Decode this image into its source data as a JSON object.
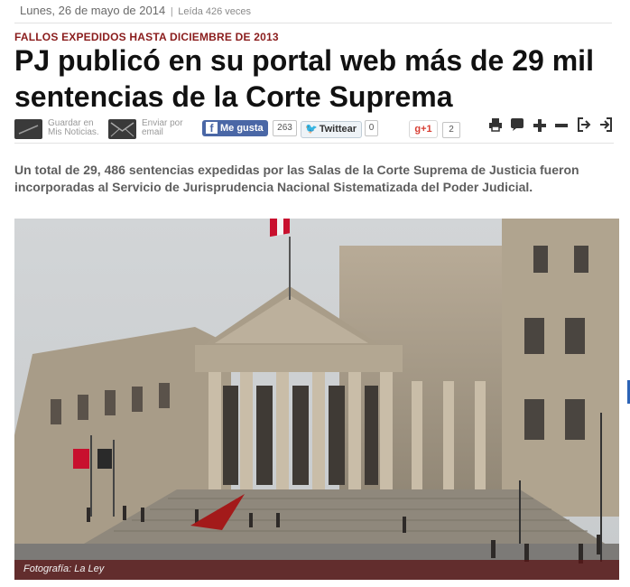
{
  "meta": {
    "date": "Lunes,  26 de mayo de 2014",
    "separator": "|",
    "reads": "Leída 426 veces"
  },
  "article": {
    "kicker": "FALLOS EXPEDIDOS HASTA DICIEMBRE DE 2013",
    "headline": "PJ publicó en su portal web más de 29 mil sentencias de la Corte Suprema",
    "lead": "Un total de 29, 486 sentencias expedidas por las Salas de la Corte Suprema de Justicia fueron incorporadas al Servicio de Jurisprudencia Nacional Sistematizada del Poder Judicial.",
    "photo_caption": "Fotografía: La Ley"
  },
  "toolbar": {
    "save_line1": "Guardar en",
    "save_line2": "Mis Noticias.",
    "email_line1": "Enviar por",
    "email_line2": "email",
    "facebook_label": "Me gusta",
    "facebook_count": "263",
    "twitter_label": "Twittear",
    "twitter_count": "0",
    "gplus_label": "+1",
    "gplus_count": "2"
  },
  "icons": {
    "print": "print-icon",
    "comment": "comment-icon",
    "font_increase": "plus-icon",
    "font_decrease": "minus-icon",
    "share_in": "login-icon",
    "share_out": "logout-icon"
  },
  "colors": {
    "kicker": "#8a1c1c",
    "facebook": "#4a67a6",
    "caption_bar": "#5a1414",
    "flag_red": "#c8102e"
  }
}
